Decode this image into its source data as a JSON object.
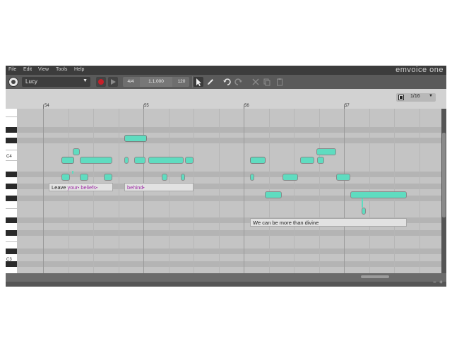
{
  "menu": [
    "File",
    "Edit",
    "View",
    "Tools",
    "Help"
  ],
  "brand": "emvoice one",
  "toolbar": {
    "voice": "Lucy",
    "time_signature": "4/4",
    "position": "1.1.000",
    "tempo": "120"
  },
  "ruler": {
    "bars": [
      "54",
      "55",
      "56",
      "57"
    ],
    "snap": "1/16"
  },
  "keyboard": {
    "c4_label": "C4",
    "c3_label": "C3"
  },
  "lyrics": [
    {
      "words": [
        {
          "text": "Leave ",
          "sung": false
        },
        {
          "text": "your",
          "sung": true
        },
        {
          "text": "•",
          "sung": true
        },
        {
          "text": " ",
          "sung": false
        },
        {
          "text": "beliefs",
          "sung": true
        },
        {
          "text": "•",
          "sung": true
        }
      ]
    },
    {
      "words": [
        {
          "text": "behind",
          "sung": true
        },
        {
          "text": "•",
          "sung": true
        }
      ]
    },
    {
      "words": [
        {
          "text": "We can be more than divine",
          "sung": false
        }
      ]
    }
  ],
  "zoom": {
    "minus": "−",
    "plus": "+"
  },
  "colors": {
    "note_fill": "#5fdcc0",
    "record": "#c8202a",
    "lyric_sung": "#a02fa8"
  },
  "icons": [
    "app-logo-icon",
    "record-icon",
    "play-icon",
    "pointer-icon",
    "pencil-icon",
    "undo-icon",
    "redo-icon",
    "cut-icon",
    "copy-icon",
    "paste-icon"
  ]
}
